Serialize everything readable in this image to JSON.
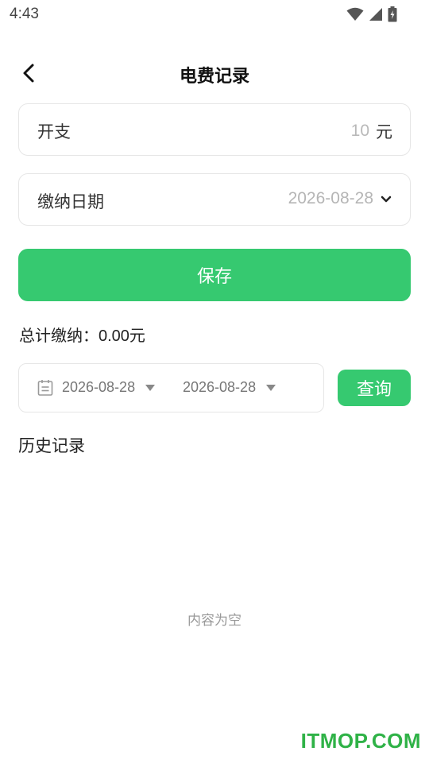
{
  "status_bar": {
    "time": "4:43"
  },
  "header": {
    "title": "电费记录"
  },
  "expense": {
    "label": "开支",
    "value": "10",
    "unit": "元"
  },
  "payment_date": {
    "label": "缴纳日期",
    "value": "2026-08-28"
  },
  "save_button": {
    "label": "保存"
  },
  "total": {
    "label": "总计缴纳：",
    "amount": "0.00元"
  },
  "filter": {
    "start_date": "2026-08-28",
    "end_date": "2026-08-28",
    "query_label": "查询"
  },
  "history": {
    "title": "历史记录",
    "empty_text": "内容为空"
  },
  "watermark": {
    "text": "ITMOP.COM"
  },
  "colors": {
    "accent": "#36c970",
    "watermark": "#2fb247"
  },
  "icons": [
    "wifi-icon",
    "signal-icon",
    "battery-icon",
    "back-arrow-icon",
    "chevron-down-icon",
    "calendar-icon",
    "dropdown-triangle-icon"
  ]
}
